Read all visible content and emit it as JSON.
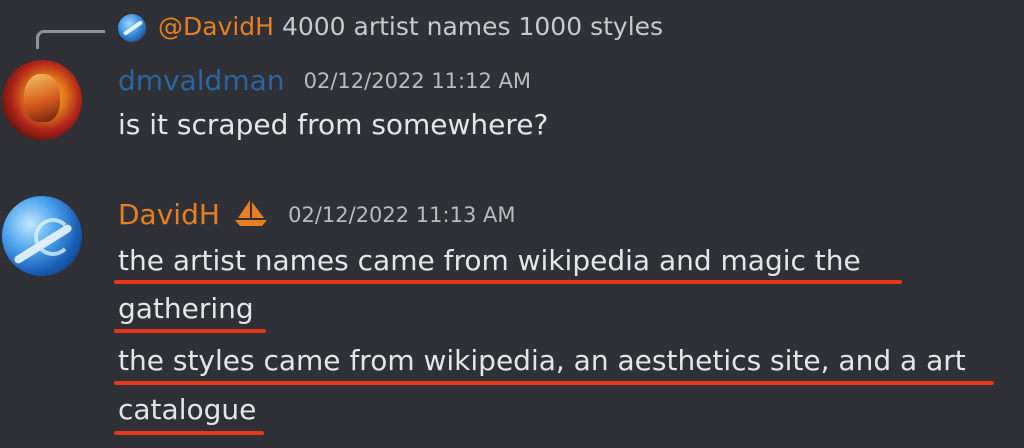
{
  "reply": {
    "author": "@DavidH",
    "content": "4000 artist names 1000 styles"
  },
  "messages": [
    {
      "author": "dmvaldman",
      "timestamp": "02/12/2022 11:12 AM",
      "lines": [
        "is it scraped from somewhere?"
      ]
    },
    {
      "author": "DavidH",
      "badge_icon": "sailboat-icon",
      "timestamp": "02/12/2022 11:13 AM",
      "lines": [
        "the artist names came from wikipedia and magic the",
        "gathering",
        "the styles came from wikipedia, an aesthetics site, and a art",
        "catalogue"
      ]
    }
  ],
  "colors": {
    "background": "#2f3136",
    "mention_author": "#e67e22",
    "annotation_underline": "#e8361a"
  }
}
